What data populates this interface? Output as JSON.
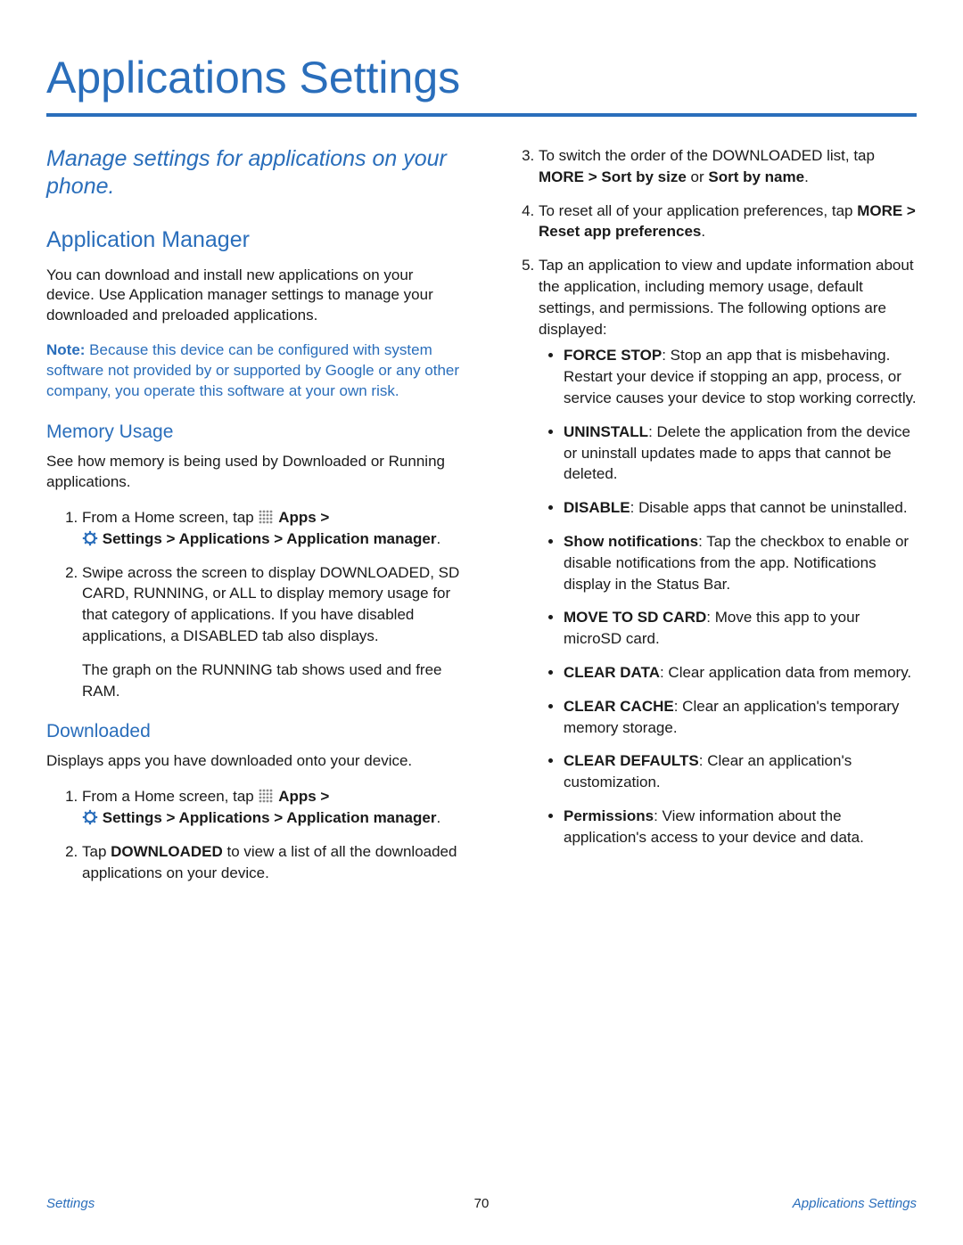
{
  "title": "Applications Settings",
  "intro": "Manage settings for applications on your phone.",
  "left": {
    "section_heading": "Application Manager",
    "p1": "You can download and install new applications on your device. Use Application manager settings to manage your downloaded and preloaded applications.",
    "note_label": "Note:",
    "note_body": " Because this device can be configured with system software not provided by or supported by Google or any other company, you operate this software at your own risk.",
    "sub_memory_heading": "Memory Usage",
    "memory_p1": "See how memory is being used by Downloaded or Running applications.",
    "mem_li1_a": "From a Home screen, tap ",
    "mem_li1_apps": "Apps >",
    "mem_li1_settings": "Settings > Applications > Application manager",
    "mem_li1_end": ".",
    "mem_li2": "Swipe across the screen to display DOWNLOADED, SD CARD, RUNNING, or ALL to display memory usage for that category of applications. If you have disabled applications, a DISABLED tab also displays.",
    "mem_li2b": "The graph on the RUNNING tab shows used and free RAM.",
    "sub_downloaded_heading": "Downloaded",
    "downloaded_p1": "Displays apps you have downloaded onto your device.",
    "down_li1_a": "From a Home screen, tap ",
    "down_li1_apps": "Apps >",
    "down_li1_settings": "Settings > Applications > Application manager",
    "down_li1_end": ".",
    "down_li2_a": "Tap ",
    "down_li2_b": "DOWNLOADED",
    "down_li2_c": " to view a list of all the downloaded applications on your device."
  },
  "right": {
    "li3_a": "To switch the order of the DOWNLOADED list, tap ",
    "li3_b": "MORE > Sort by size",
    "li3_c": " or ",
    "li3_d": "Sort by name",
    "li3_e": ".",
    "li4_a": "To reset all of your application preferences, tap ",
    "li4_b": "MORE > Reset app preferences",
    "li4_c": ".",
    "li5_a": "Tap an application to view and update information about the application, including memory usage, default settings, and permissions. The following options are displayed:",
    "b1_h": "FORCE STOP",
    "b1_t": ": Stop an app that is misbehaving. Restart your device if stopping an app, process, or service causes your device to stop working correctly.",
    "b2_h": "UNINSTALL",
    "b2_t": ": Delete the application from the device or uninstall updates made to apps that cannot be deleted.",
    "b3_h": "DISABLE",
    "b3_t": ": Disable apps that cannot be uninstalled.",
    "b4_h": "Show notifications",
    "b4_t": ": Tap the checkbox to enable or disable notifications from the app. Notifications display in the Status Bar.",
    "b5_h": "MOVE TO SD CARD",
    "b5_t": ": Move this app to your microSD card.",
    "b6_h": "CLEAR DATA",
    "b6_t": ": Clear application data from memory.",
    "b7_h": "CLEAR CACHE",
    "b7_t": ": Clear an application's temporary memory storage.",
    "b8_h": "CLEAR DEFAULTS",
    "b8_t": ": Clear an application's customization.",
    "b9_h": "Permissions",
    "b9_t": ": View information about the application's access to your device and data."
  },
  "footer": {
    "left": "Settings",
    "page": "70",
    "right": "Applications Settings"
  }
}
